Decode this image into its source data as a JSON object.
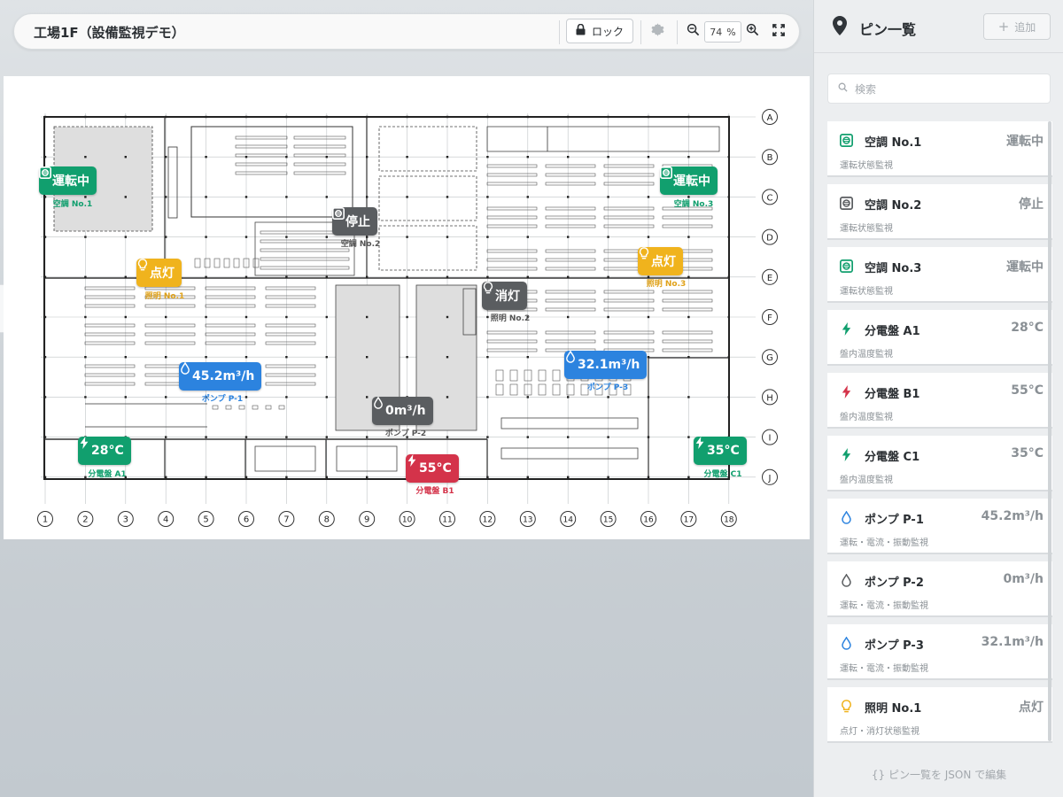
{
  "toolbar": {
    "title": "工場1F（設備監視デモ）",
    "lock_label": "ロック",
    "zoom_value": "74",
    "zoom_unit": "%"
  },
  "floorplan": {
    "row_labels": [
      "A",
      "B",
      "C",
      "D",
      "E",
      "F",
      "G",
      "H",
      "I",
      "J"
    ],
    "col_labels": [
      "1",
      "2",
      "3",
      "4",
      "5",
      "6",
      "7",
      "8",
      "9",
      "10",
      "11",
      "12",
      "13",
      "14",
      "15",
      "16",
      "17",
      "18"
    ],
    "pins": [
      {
        "id": "ac1",
        "icon": "ac-unit-icon",
        "color": "green",
        "value": "運転中",
        "label": "空調 No.1"
      },
      {
        "id": "ac2",
        "icon": "ac-unit-icon",
        "color": "gray",
        "value": "停止",
        "label": "空調 No.2"
      },
      {
        "id": "ac3",
        "icon": "ac-unit-icon",
        "color": "green",
        "value": "運転中",
        "label": "空調 No.3"
      },
      {
        "id": "l1",
        "icon": "lightbulb-icon",
        "color": "yellow",
        "value": "点灯",
        "label": "照明 No.1"
      },
      {
        "id": "l2",
        "icon": "lightbulb-icon",
        "color": "gray",
        "value": "消灯",
        "label": "照明 No.2"
      },
      {
        "id": "l3",
        "icon": "lightbulb-icon",
        "color": "yellow",
        "value": "点灯",
        "label": "照明 No.3"
      },
      {
        "id": "p1",
        "icon": "water-drop-icon",
        "color": "blue",
        "value": "45.2m³/h",
        "label": "ポンプ P-1"
      },
      {
        "id": "p2",
        "icon": "water-drop-icon",
        "color": "gray",
        "value": "0m³/h",
        "label": "ポンプ P-2"
      },
      {
        "id": "p3",
        "icon": "water-drop-icon",
        "color": "blue",
        "value": "32.1m³/h",
        "label": "ポンプ P-3"
      },
      {
        "id": "a1",
        "icon": "lightning-icon",
        "color": "green",
        "value": "28°C",
        "label": "分電盤 A1"
      },
      {
        "id": "b1",
        "icon": "lightning-icon",
        "color": "red",
        "value": "55°C",
        "label": "分電盤 B1"
      },
      {
        "id": "c1",
        "icon": "lightning-icon",
        "color": "green",
        "value": "35°C",
        "label": "分電盤 C1"
      }
    ]
  },
  "panel": {
    "title": "ピン一覧",
    "add_label": "追加",
    "search_placeholder": "検索",
    "json_edit_label": "ピン一覧を JSON で編集",
    "items": [
      {
        "name": "空調 No.1",
        "value": "運転中",
        "desc": "運転状態監視",
        "icon": "ac-unit-icon",
        "color": "#119f6e"
      },
      {
        "name": "空調 No.2",
        "value": "停止",
        "desc": "運転状態監視",
        "icon": "ac-unit-icon",
        "color": "#5a5d60"
      },
      {
        "name": "空調 No.3",
        "value": "運転中",
        "desc": "運転状態監視",
        "icon": "ac-unit-icon",
        "color": "#119f6e"
      },
      {
        "name": "分電盤 A1",
        "value": "28°C",
        "desc": "盤内温度監視",
        "icon": "lightning-icon",
        "color": "#119f6e"
      },
      {
        "name": "分電盤 B1",
        "value": "55°C",
        "desc": "盤内温度監視",
        "icon": "lightning-icon",
        "color": "#d4334a"
      },
      {
        "name": "分電盤 C1",
        "value": "35°C",
        "desc": "盤内温度監視",
        "icon": "lightning-icon",
        "color": "#119f6e"
      },
      {
        "name": "ポンプ P-1",
        "value": "45.2m³/h",
        "desc": "運転・電流・振動監視",
        "icon": "water-drop-icon",
        "color": "#2c83df"
      },
      {
        "name": "ポンプ P-2",
        "value": "0m³/h",
        "desc": "運転・電流・振動監視",
        "icon": "water-drop-icon",
        "color": "#5a5d60"
      },
      {
        "name": "ポンプ P-3",
        "value": "32.1m³/h",
        "desc": "運転・電流・振動監視",
        "icon": "water-drop-icon",
        "color": "#2c83df"
      },
      {
        "name": "照明 No.1",
        "value": "点灯",
        "desc": "点灯・消灯状態監視",
        "icon": "lightbulb-icon",
        "color": "#f0b31d"
      }
    ]
  }
}
